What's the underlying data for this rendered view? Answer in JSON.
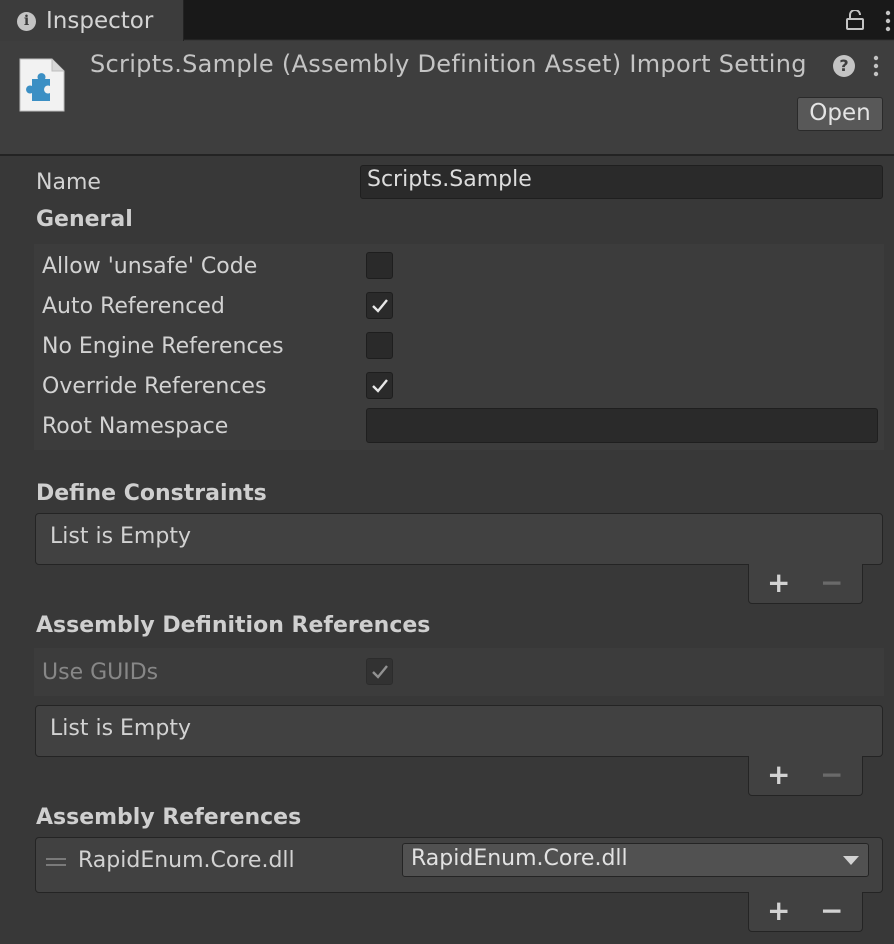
{
  "tab": {
    "label": "Inspector"
  },
  "header": {
    "title": "Scripts.Sample (Assembly Definition Asset) Import Setting",
    "open_label": "Open"
  },
  "name_field": {
    "label": "Name",
    "value": "Scripts.Sample"
  },
  "general": {
    "heading": "General",
    "allow_unsafe": {
      "label": "Allow 'unsafe' Code",
      "checked": false
    },
    "auto_referenced": {
      "label": "Auto Referenced",
      "checked": true
    },
    "no_engine_refs": {
      "label": "No Engine References",
      "checked": false
    },
    "override_refs": {
      "label": "Override References",
      "checked": true
    },
    "root_namespace": {
      "label": "Root Namespace",
      "value": ""
    }
  },
  "define_constraints": {
    "heading": "Define Constraints",
    "empty_text": "List is Empty",
    "add": "+",
    "remove": "−"
  },
  "asmdef_refs": {
    "heading": "Assembly Definition References",
    "use_guids": {
      "label": "Use GUIDs",
      "checked": true
    },
    "empty_text": "List is Empty",
    "add": "+",
    "remove": "−"
  },
  "assembly_refs": {
    "heading": "Assembly References",
    "items": [
      {
        "label": "RapidEnum.Core.dll",
        "selected": "RapidEnum.Core.dll"
      }
    ],
    "add": "+",
    "remove": "−"
  },
  "colors": {
    "background": "#383838",
    "header": "#3e3e3e",
    "field": "#2a2a2a",
    "text": "#d2d2d2"
  }
}
